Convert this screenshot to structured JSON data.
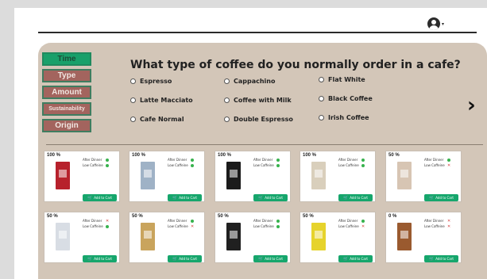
{
  "question": "What type of coffee do you normally order in a cafe?",
  "tabs": [
    {
      "label": "Time",
      "state": "active"
    },
    {
      "label": "Type",
      "state": "inactive"
    },
    {
      "label": "Amount",
      "state": "inactive"
    },
    {
      "label": "Sustainability",
      "state": "inactive"
    },
    {
      "label": "Origin",
      "state": "inactive"
    }
  ],
  "options": [
    "Espresso",
    "Cappachino",
    "Flat White",
    "Latte Macciato",
    "Coffee with Milk",
    "Black Coffee",
    "Cafe Normal",
    "Double Espresso",
    "Irish Coffee"
  ],
  "meta_labels": {
    "after_dinner": "After Dinner",
    "low_caffeine": "Low Caffeine"
  },
  "cart_label": "Add to Cart",
  "products": [
    {
      "pct": "100 %",
      "after_dinner": "ok",
      "low_caffeine": "ok",
      "pkg_color": "#b7212c"
    },
    {
      "pct": "100 %",
      "after_dinner": "ok",
      "low_caffeine": "ok",
      "pkg_color": "#9fb2c6"
    },
    {
      "pct": "100 %",
      "after_dinner": "ok",
      "low_caffeine": "ok",
      "pkg_color": "#1b1b1b"
    },
    {
      "pct": "100 %",
      "after_dinner": "ok",
      "low_caffeine": "ok",
      "pkg_color": "#d9cfbc"
    },
    {
      "pct": "50 %",
      "after_dinner": "ok",
      "low_caffeine": "no",
      "pkg_color": "#d7c5b3"
    },
    {
      "pct": "50 %",
      "after_dinner": "no",
      "low_caffeine": "ok",
      "pkg_color": "#d8dde4"
    },
    {
      "pct": "50 %",
      "after_dinner": "ok",
      "low_caffeine": "no",
      "pkg_color": "#c9a45d"
    },
    {
      "pct": "50 %",
      "after_dinner": "ok",
      "low_caffeine": "ok",
      "pkg_color": "#202020"
    },
    {
      "pct": "50 %",
      "after_dinner": "ok",
      "low_caffeine": "no",
      "pkg_color": "#e6d32c"
    },
    {
      "pct": "0 %",
      "after_dinner": "no",
      "low_caffeine": "no",
      "pkg_color": "#9a5a2f"
    }
  ],
  "colors": {
    "accent": "#19a06a",
    "tab_inactive": "#a3645e",
    "panel": "#d3c6b8"
  }
}
